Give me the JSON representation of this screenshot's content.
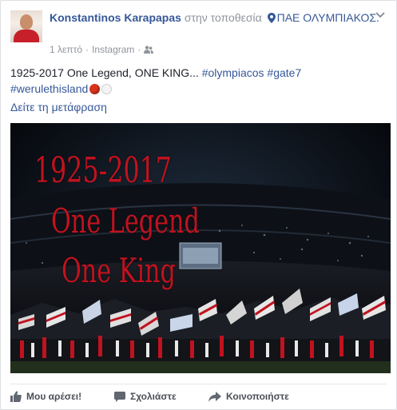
{
  "post": {
    "author_name": "Konstantinos Karapapas",
    "location_prefix": "στην τοποθεσία",
    "location_name": "ΠΑΕ ΟΛΥΜΠΙΑΚΟΣ.",
    "timestamp": "1 λεπτό",
    "source": "Instagram",
    "audience_icon": "friends-icon",
    "text_main": "1925-2017 One Legend, ONE KING...",
    "hashtags": [
      "#olympiacos",
      "#gate7",
      "#werulethisland"
    ],
    "emoji": [
      "red-circle",
      "white-circle"
    ],
    "translate_link": "Δείτε τη μετάφραση",
    "photo_text": [
      "1925-2017",
      "One Legend",
      "One King"
    ]
  },
  "actions": {
    "like": "Μου αρέσει!",
    "comment": "Σχολιάστε",
    "share": "Κοινοποιήστε"
  },
  "colors": {
    "link": "#365899",
    "muted": "#90949c",
    "photo_text": "#c1121f",
    "photo_bg": "#07090e"
  }
}
